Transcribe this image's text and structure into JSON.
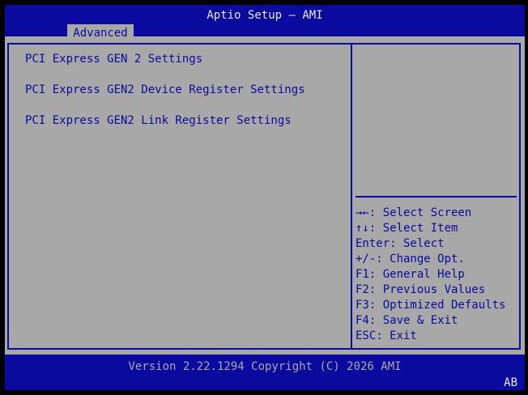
{
  "header": {
    "title": "Aptio Setup – AMI",
    "tabs": [
      {
        "label": "Advanced",
        "selected": true
      }
    ]
  },
  "menu": {
    "items": [
      {
        "label": "PCI Express GEN 2 Settings"
      },
      {
        "label": "PCI Express GEN2 Device Register Settings"
      },
      {
        "label": "PCI Express GEN2 Link Register Settings"
      }
    ]
  },
  "help": {
    "keys": [
      {
        "text": "→←: Select Screen",
        "icon": "left-right-arrows-icon"
      },
      {
        "text": "↑↓: Select Item",
        "icon": "up-down-arrows-icon"
      },
      {
        "text": "Enter: Select"
      },
      {
        "text": "+/-: Change Opt."
      },
      {
        "text": "F1: General Help"
      },
      {
        "text": "F2: Previous Values"
      },
      {
        "text": "F3: Optimized Defaults"
      },
      {
        "text": "F4: Save & Exit"
      },
      {
        "text": "ESC: Exit"
      }
    ]
  },
  "footer": {
    "version": "Version 2.22.1294 Copyright (C) 2026 AMI",
    "indicator": "AB"
  },
  "colors": {
    "bar_blue": "#0a0a9e",
    "panel_gray": "#a8a8a8",
    "title_white": "#e8e8e8"
  }
}
